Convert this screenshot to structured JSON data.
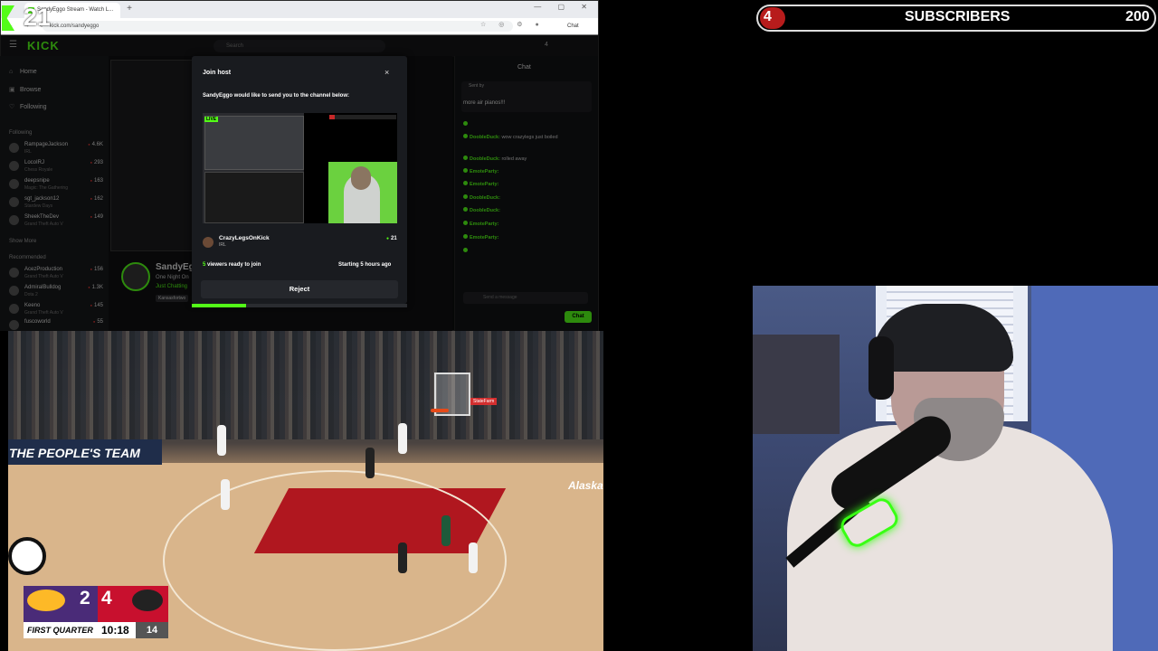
{
  "browser": {
    "tab_title": "SandyEggo Stream - Watch L...",
    "url": "kick.com/sandyeggo",
    "chat_button": "Chat",
    "new_tab": "+"
  },
  "kick": {
    "logo": "KICK",
    "search_placeholder": "Search",
    "header_count": "4",
    "nav": [
      "Home",
      "Browse",
      "Following"
    ],
    "following_title": "Following",
    "following": [
      {
        "name": "RampageJackson",
        "sub": "IRL",
        "viewers": "4.6K"
      },
      {
        "name": "LocoIRJ",
        "sub": "Chess Royale",
        "viewers": "293"
      },
      {
        "name": "deepsnipe",
        "sub": "Magic: The Gathering",
        "viewers": "163"
      },
      {
        "name": "sgt_jackson12",
        "sub": "Stardew Days",
        "viewers": "162"
      },
      {
        "name": "SheekTheDev",
        "sub": "Grand Theft Auto V",
        "viewers": "149"
      }
    ],
    "show_more": "Show More",
    "recommended_title": "Recommended",
    "recommended": [
      {
        "name": "AcezProduction",
        "sub": "Grand Theft Auto V",
        "viewers": "156"
      },
      {
        "name": "AdmiralBulldog",
        "sub": "Dota 2",
        "viewers": "1.3K"
      },
      {
        "name": "Keeno",
        "sub": "Grand Theft Auto V",
        "viewers": "145"
      },
      {
        "name": "fuscoworld",
        "sub": "",
        "viewers": "55"
      }
    ],
    "streamer": "SandyEg",
    "stream_title": "One Night On",
    "stream_category": "Just Chatting",
    "stream_tag": "Kansasfortwo",
    "chat_title": "Chat",
    "pin_label": "Sent by",
    "pin_message": "more air pianos!!!",
    "chat_messages": [
      {
        "user": "",
        "text": "",
        "red": true
      },
      {
        "user": "DoobleDuck:",
        "text": "wow crazylegs just boiled",
        "red": false
      },
      {
        "user": "DoobleDuck:",
        "text": "rolled away",
        "red": false
      },
      {
        "user": "EmoteParty:",
        "text": "",
        "red": false
      },
      {
        "user": "EmoteParty:",
        "text": "",
        "red": false
      },
      {
        "user": "DoobleDuck:",
        "text": "",
        "red": false
      },
      {
        "user": "DoobleDuck:",
        "text": "",
        "red": false
      },
      {
        "user": "EmoteParty:",
        "text": "",
        "red": false
      },
      {
        "user": "EmoteParty:",
        "text": "",
        "red": false
      },
      {
        "user": "",
        "text": "",
        "red": true
      }
    ],
    "chat_placeholder": "Send a message",
    "chat_send": "Chat"
  },
  "modal": {
    "title": "Join host",
    "close": "×",
    "message": "SandyEggo would like to send you to the channel below:",
    "preview_live": "LIVE",
    "host_name": "CrazyLegsOnKick",
    "host_category": "IRL",
    "host_viewers": "21",
    "ready_count": "5",
    "ready_text": " viewers ready to join",
    "starting": "Starting 5 hours ago",
    "reject": "Reject",
    "progress": 0.25
  },
  "overlay": {
    "counter": "21",
    "sub_count": "4",
    "sub_label": "SUBSCRIBERS",
    "sub_goal": "200"
  },
  "game": {
    "ad_text": "THE PEOPLE'S TEAM",
    "home_score": "2",
    "away_score": "4",
    "quarter": "FIRST QUARTER",
    "clock": "10:18",
    "shot_clock": "14",
    "sponsor": "Alaska",
    "statefarm": "StateFarm"
  },
  "colors": {
    "kick_green": "#53fc18",
    "sub_red": "#b71c1c",
    "lakers_purple": "#4a2b78",
    "blazers_red": "#c8102e"
  }
}
